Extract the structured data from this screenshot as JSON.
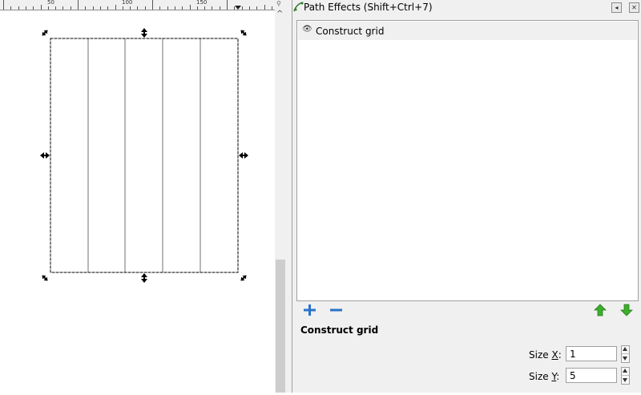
{
  "ruler": {
    "labels": [
      "50",
      "100",
      "150"
    ]
  },
  "canvas": {
    "grid_columns": 5,
    "grid_rows": 1
  },
  "panel": {
    "title": "Path Effects  (Shift+Ctrl+7)",
    "title_buttons": [
      "◂",
      "✕"
    ],
    "effects": [
      {
        "label": "Construct grid",
        "visible": true
      }
    ],
    "toolbar": {
      "add_icon": "plus-icon",
      "remove_icon": "minus-icon",
      "raise_icon": "arrow-up-icon",
      "lower_icon": "arrow-down-icon"
    },
    "current_effect": "Construct grid",
    "params": {
      "size_x": {
        "label_prefix": "Size ",
        "label_key": "X",
        "label_suffix": ":",
        "value": "1"
      },
      "size_y": {
        "label_prefix": "Size ",
        "label_key": "Y",
        "label_suffix": ":",
        "value": "5"
      }
    }
  },
  "colors": {
    "panel_bg": "#f0f0f0",
    "accent_add": "#2a73c9",
    "accent_arrows": "#3cae2b"
  }
}
